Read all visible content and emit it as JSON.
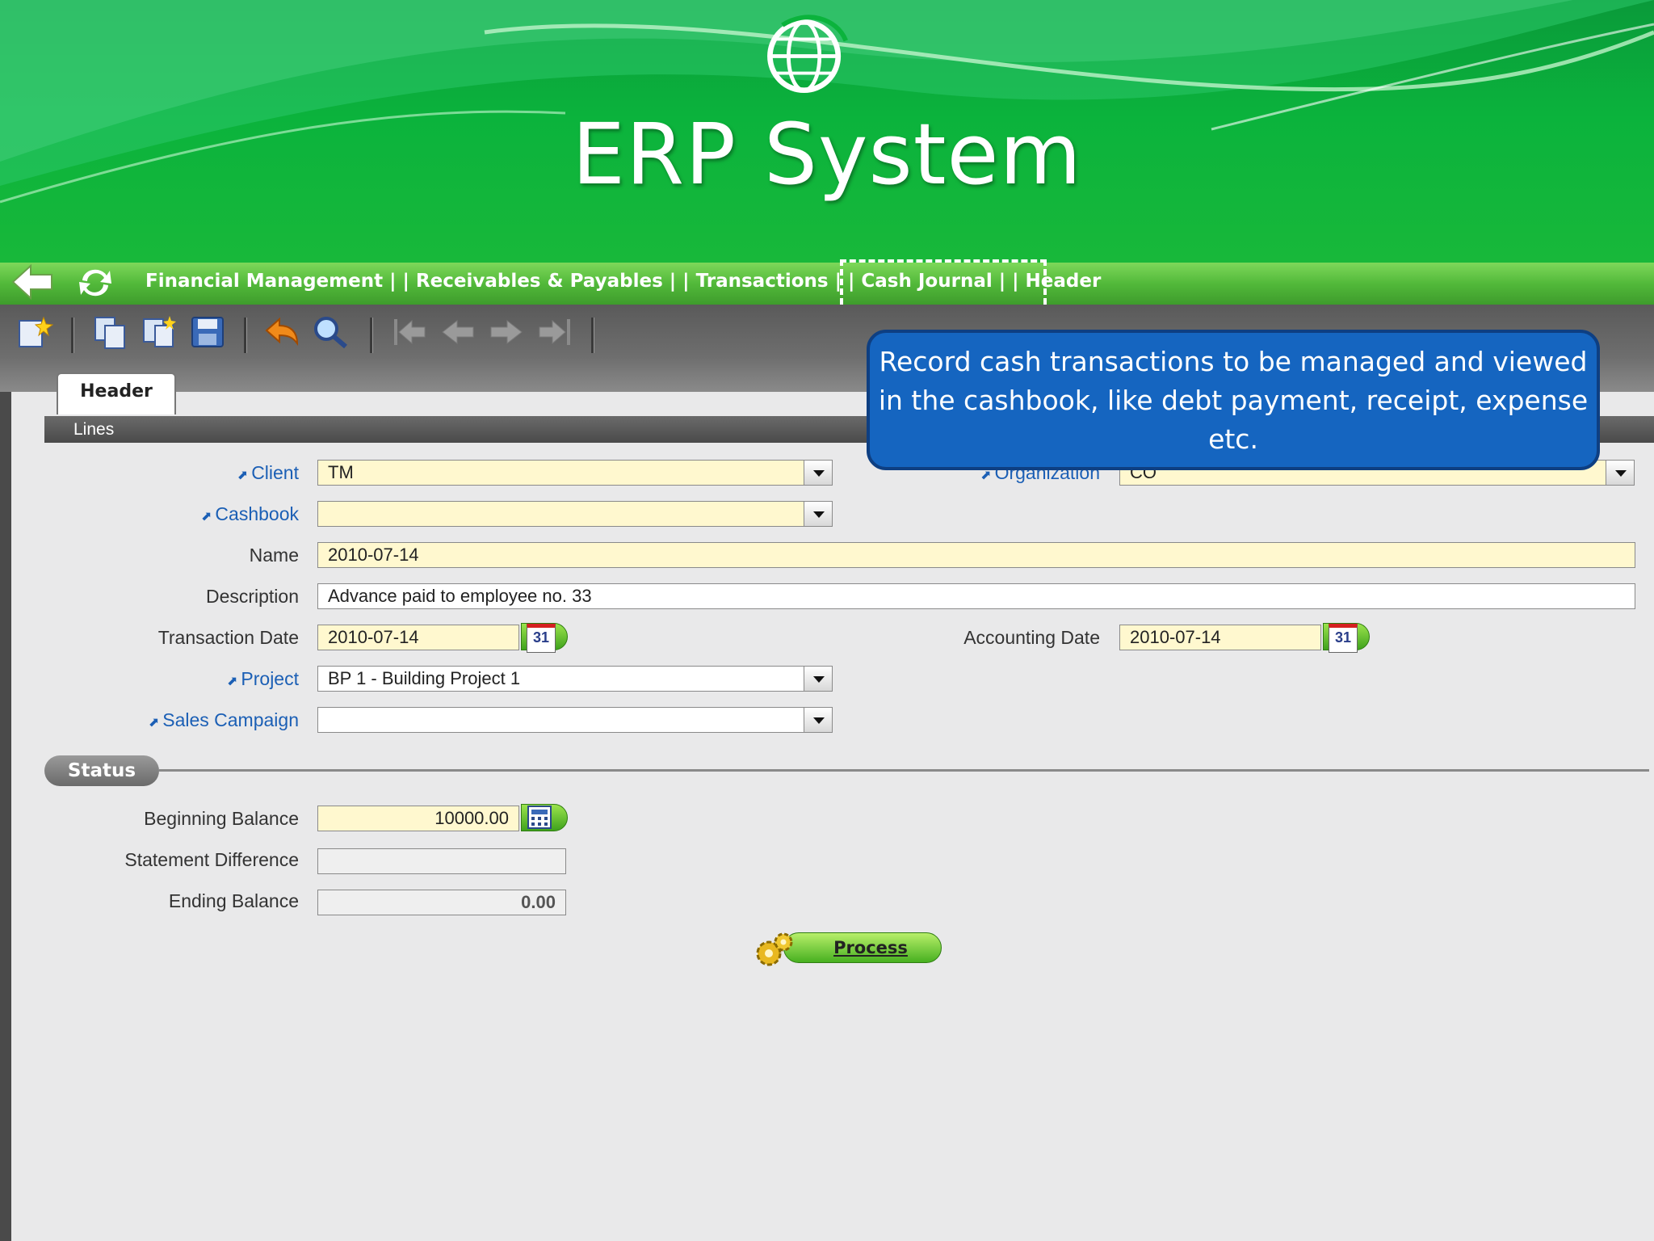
{
  "banner": {
    "title": "ERP System"
  },
  "nav": {
    "breadcrumb": "Financial Management | | Receivables & Payables | | Transactions | | Cash Journal  | | Header"
  },
  "toolbar": {
    "buttons": [
      "new-record",
      "copy-record",
      "paste-record",
      "save",
      "undo",
      "find",
      "first",
      "previous",
      "next",
      "last"
    ]
  },
  "tabs": {
    "header": "Header",
    "lines": "Lines"
  },
  "callout": {
    "text": "Record  cash transactions to be managed and viewed in the cashbook, like debt payment, receipt, expense etc."
  },
  "form": {
    "client": {
      "label": "Client",
      "value": "TM"
    },
    "organization": {
      "label": "Organization",
      "value": "CO"
    },
    "cashbook": {
      "label": "Cashbook",
      "value": ""
    },
    "name": {
      "label": "Name",
      "value": "2010-07-14"
    },
    "description": {
      "label": "Description",
      "value": "Advance paid to employee no. 33"
    },
    "transaction_date": {
      "label": "Transaction Date",
      "value": "2010-07-14"
    },
    "accounting_date": {
      "label": "Accounting Date",
      "value": "2010-07-14"
    },
    "project": {
      "label": "Project",
      "value": "BP 1 - Building Project 1"
    },
    "sales_campaign": {
      "label": "Sales Campaign",
      "value": ""
    },
    "calendar_day": "31"
  },
  "status": {
    "title": "Status",
    "beginning_balance": {
      "label": "Beginning Balance",
      "value": "10000.00"
    },
    "statement_difference": {
      "label": "Statement Difference",
      "value": ""
    },
    "ending_balance": {
      "label": "Ending Balance",
      "value": "0.00"
    }
  },
  "process_button": "Process",
  "colors": {
    "banner_green": "#0bb33c",
    "field_yellow": "#fff8cf",
    "link_blue": "#1b5fb5",
    "callout_blue": "#1565c0"
  }
}
